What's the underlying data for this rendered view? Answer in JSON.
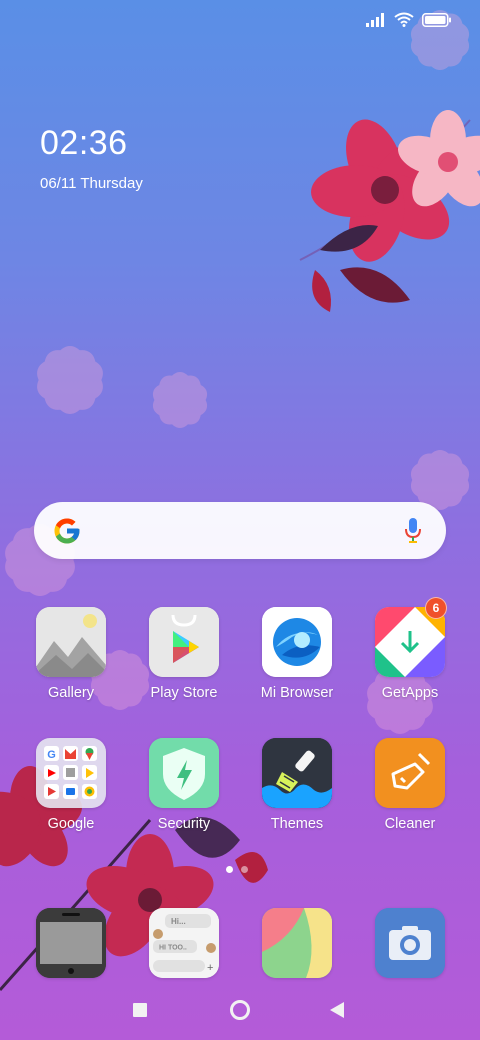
{
  "status_bar": {
    "signal_icon": "signal-bars-icon",
    "wifi_icon": "wifi-icon",
    "battery_icon": "battery-icon"
  },
  "lock": {
    "time": "02:36",
    "date": "06/11 Thursday"
  },
  "search": {
    "logo_icon": "google-g-icon",
    "mic_icon": "microphone-icon"
  },
  "apps_row1": [
    {
      "label": "Gallery",
      "icon": "gallery-icon"
    },
    {
      "label": "Play Store",
      "icon": "play-store-icon"
    },
    {
      "label": "Mi Browser",
      "icon": "mi-browser-icon"
    },
    {
      "label": "GetApps",
      "icon": "getapps-icon",
      "badge": "6"
    }
  ],
  "apps_row2": [
    {
      "label": "Google",
      "icon": "google-folder-icon"
    },
    {
      "label": "Security",
      "icon": "security-icon"
    },
    {
      "label": "Themes",
      "icon": "themes-icon"
    },
    {
      "label": "Cleaner",
      "icon": "cleaner-icon"
    }
  ],
  "dock": [
    {
      "icon": "phone-icon"
    },
    {
      "icon": "messages-icon",
      "bubble_1": "Hi...",
      "bubble_2": "HI TOO.."
    },
    {
      "icon": "notes-icon"
    },
    {
      "icon": "camera-icon"
    }
  ],
  "page_indicator": {
    "current": 1,
    "total": 2
  },
  "nav": {
    "recents_icon": "square-recents-icon",
    "home_icon": "circle-home-icon",
    "back_icon": "triangle-back-icon"
  },
  "colors": {
    "bg_top": "#5a8fe6",
    "bg_bottom": "#b45bd8",
    "badge": "#f0502a",
    "flower": "#d8335f"
  }
}
